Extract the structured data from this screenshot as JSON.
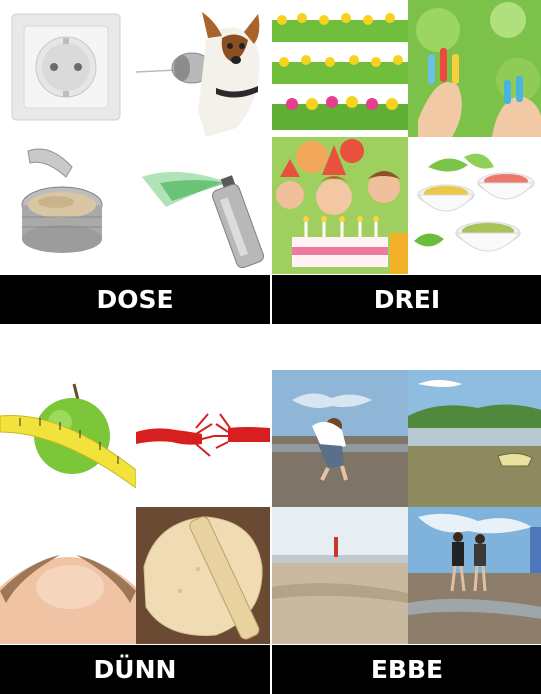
{
  "puzzles": [
    {
      "answer": "DOSE",
      "pictures": [
        "power-socket",
        "dog-with-tin-can-phone",
        "open-tuna-can",
        "spray-can"
      ]
    },
    {
      "answer": "DREI",
      "pictures": [
        "three-rows-of-tulips",
        "painted-fingers",
        "birthday-children-with-cake",
        "three-dip-bowls"
      ]
    },
    {
      "answer": "DÜNN",
      "pictures": [
        "apple-with-measuring-tape",
        "frayed-red-rope",
        "thinning-hair",
        "rolled-dough"
      ]
    },
    {
      "answer": "EBBE",
      "pictures": [
        "boy-on-mudflat",
        "tidal-shore-with-boat",
        "lighthouse-beach",
        "people-walking-mudflat"
      ]
    }
  ],
  "colors": {
    "bar_background": "#000000",
    "bar_text": "#ffffff",
    "page_background": "#ffffff"
  }
}
